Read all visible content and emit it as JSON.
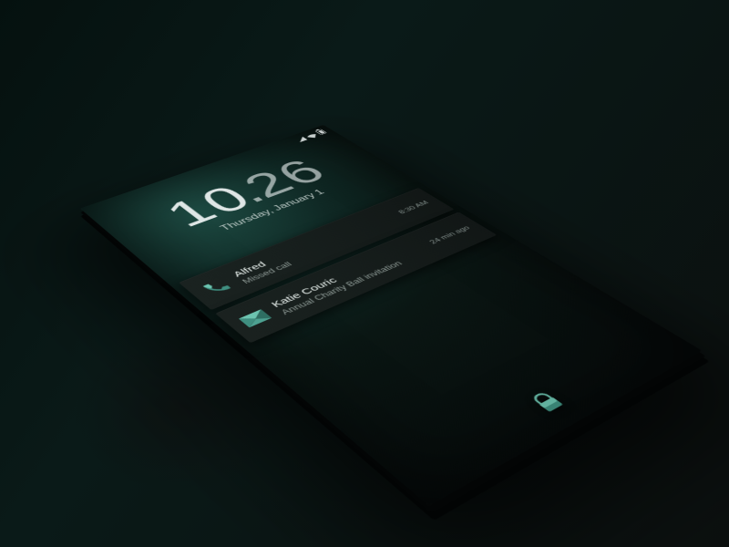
{
  "accent": "#5ea99b",
  "clock": {
    "hours": "10",
    "minutes": "26"
  },
  "date": "Thursday, January 1",
  "notifications": [
    {
      "icon": "phone",
      "title": "Alfred",
      "subtitle": "Missed call",
      "timestamp": "8:30 AM"
    },
    {
      "icon": "envelope",
      "title": "Katie Couric",
      "subtitle": "Annual Charity Ball invitation",
      "timestamp": "24 min ago"
    }
  ],
  "lock_label": "lock"
}
